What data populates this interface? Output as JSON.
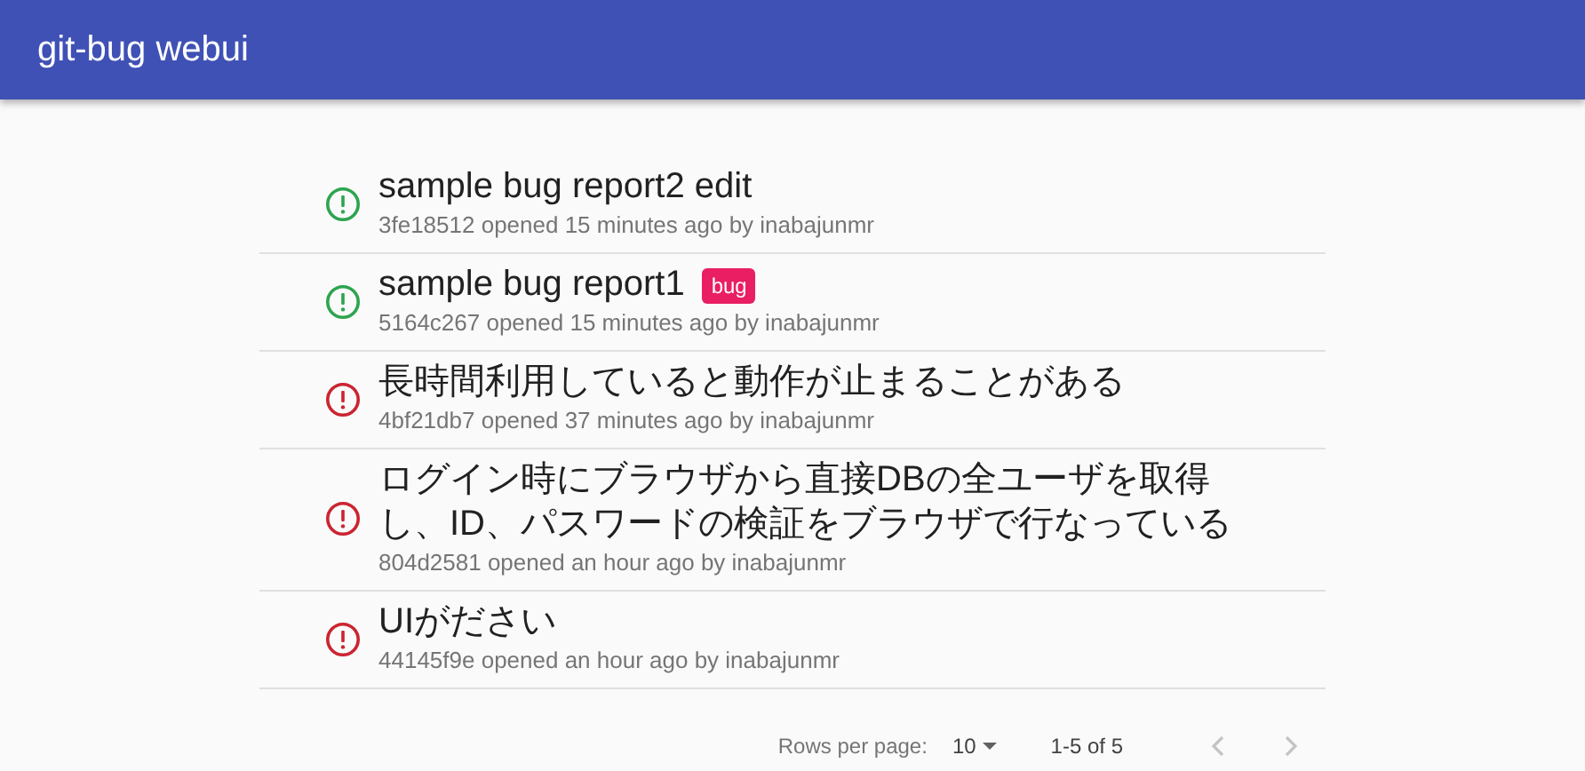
{
  "app_bar": {
    "title": "git-bug webui"
  },
  "issues": [
    {
      "title": "sample bug report2 edit",
      "meta": "3fe18512 opened 15 minutes ago by inabajunmr",
      "color": "#2ea44f"
    },
    {
      "title": "sample bug report1",
      "meta": "5164c267 opened 15 minutes ago by inabajunmr",
      "color": "#2ea44f",
      "labels": [
        {
          "text": "bug",
          "color": "#e91e63"
        }
      ]
    },
    {
      "title": "長時間利用していると動作が止まることがある",
      "meta": "4bf21db7 opened 37 minutes ago by inabajunmr",
      "color": "#cb2431"
    },
    {
      "title": "ログイン時にブラウザから直接DBの全ユーザを取得し、ID、パスワードの検証をブラウザで行なっている",
      "meta": "804d2581 opened an hour ago by inabajunmr",
      "color": "#cb2431"
    },
    {
      "title": "UIがださい",
      "meta": "44145f9e opened an hour ago by inabajunmr",
      "color": "#cb2431"
    }
  ],
  "pagination": {
    "rows_per_page_label": "Rows per page:",
    "rows_per_page": "10",
    "range": "1-5 of 5",
    "previous": {
      "disabled": true
    },
    "next": {
      "disabled": true
    }
  }
}
